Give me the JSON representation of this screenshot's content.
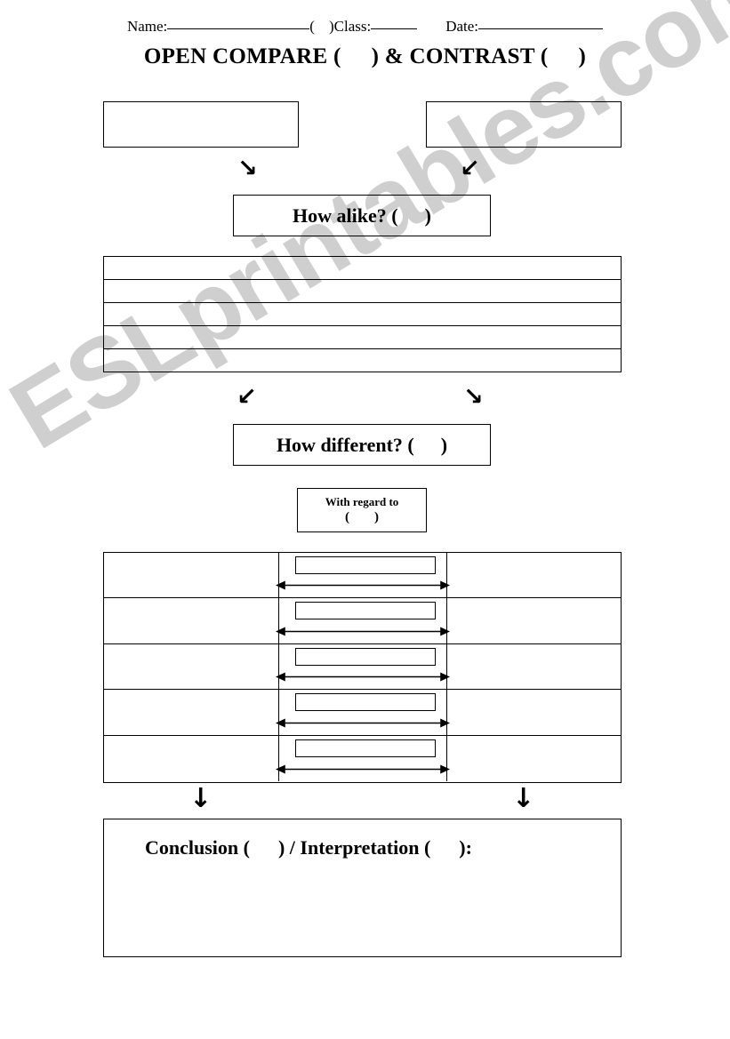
{
  "page": {
    "background": "#ffffff",
    "ink": "#000000"
  },
  "watermark": {
    "text": "ESLprintables.com",
    "color": "#cfcfcf"
  },
  "header": {
    "name_label": "Name:",
    "paren_open": "(",
    "paren_close": ")",
    "class_label": "Class:",
    "date_label": "Date:"
  },
  "title": {
    "part1": "OPEN COMPARE (",
    "part2": ") & CONTRAST (",
    "part3": ")"
  },
  "top_boxes": {
    "left": "",
    "right": ""
  },
  "arrows": {
    "down_right": "↘",
    "down_left": "↙",
    "down": "↓"
  },
  "alike": {
    "part1": "How alike? (",
    "part2": ")"
  },
  "similarities_rows": [
    "",
    "",
    "",
    "",
    ""
  ],
  "different": {
    "part1": "How different? (",
    "part2": ")"
  },
  "with_regard_to": {
    "line1": "With regard to",
    "paren_open": "(",
    "paren_close": ")"
  },
  "differences_grid": {
    "rows": [
      {
        "left": "",
        "middle": "",
        "right": ""
      },
      {
        "left": "",
        "middle": "",
        "right": ""
      },
      {
        "left": "",
        "middle": "",
        "right": ""
      },
      {
        "left": "",
        "middle": "",
        "right": ""
      },
      {
        "left": "",
        "middle": "",
        "right": ""
      }
    ]
  },
  "conclusion": {
    "part1": "Conclusion (",
    "part2": ") / Interpretation (",
    "part3": "):",
    "body": ""
  }
}
